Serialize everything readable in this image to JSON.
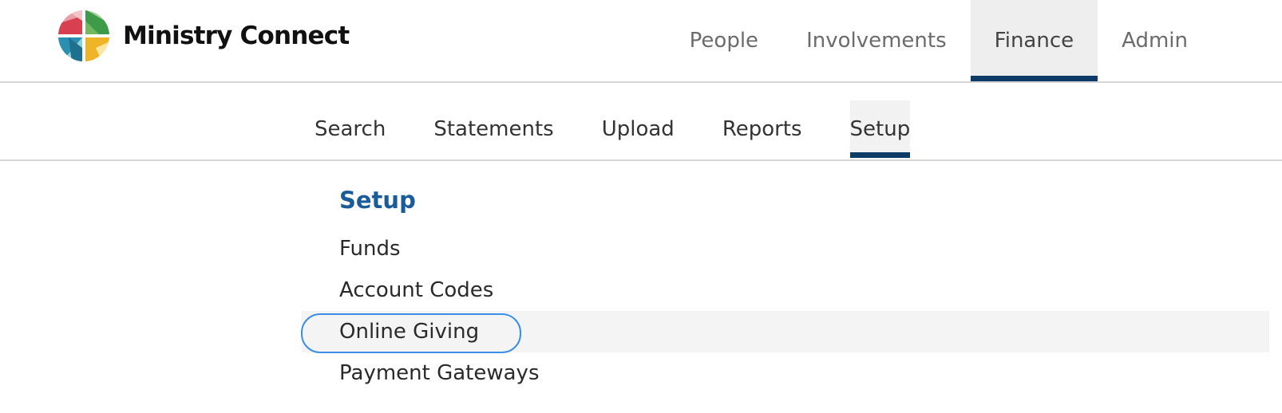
{
  "app": {
    "brand_name": "Ministry Connect"
  },
  "main_nav": {
    "items": [
      {
        "label": "People"
      },
      {
        "label": "Involvements"
      },
      {
        "label": "Finance"
      },
      {
        "label": "Admin"
      }
    ],
    "active": "Finance"
  },
  "sub_nav": {
    "items": [
      {
        "label": "Search"
      },
      {
        "label": "Statements"
      },
      {
        "label": "Upload"
      },
      {
        "label": "Reports"
      },
      {
        "label": "Setup"
      }
    ],
    "active": "Setup"
  },
  "setup": {
    "title": "Setup",
    "items": [
      {
        "label": "Funds"
      },
      {
        "label": "Account Codes"
      },
      {
        "label": "Online Giving"
      },
      {
        "label": "Payment Gateways"
      }
    ],
    "focused": "Online Giving"
  },
  "colors": {
    "accent": "#0b3b66",
    "title": "#1a5c9a",
    "focus_ring": "#3a8ee6"
  },
  "icons": {
    "logo": "ministry-connect-logo-icon"
  }
}
